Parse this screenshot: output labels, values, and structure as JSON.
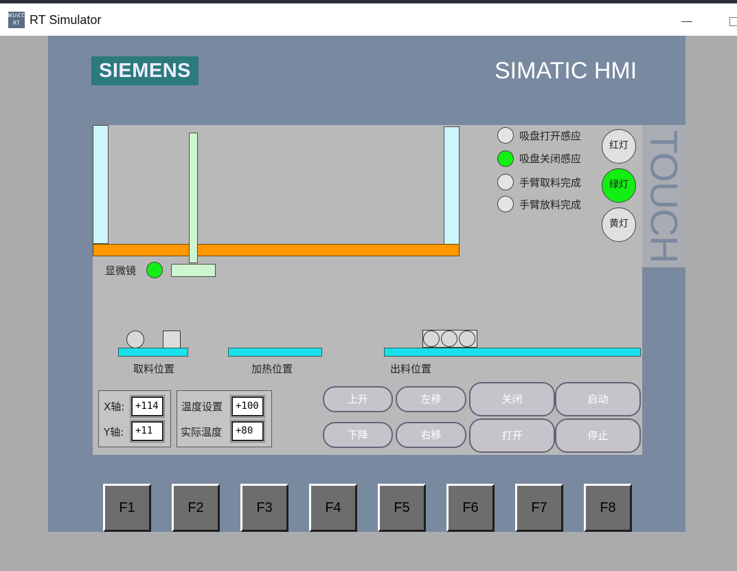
{
  "window": {
    "app_icon_text": [
      "WinCC",
      "RT"
    ],
    "title": "RT Simulator"
  },
  "panel": {
    "brand": "SIEMENS",
    "product": "SIMATIC HMI",
    "touch_label": "TOUCH"
  },
  "process": {
    "microscope_label": "显微镜",
    "positions": {
      "pick": "取料位置",
      "heat": "加热位置",
      "output": "出料位置"
    }
  },
  "sensors": [
    {
      "label": "吸盘打开感应",
      "active": false
    },
    {
      "label": "吸盘关闭感应",
      "active": true
    },
    {
      "label": "手臂取料完成",
      "active": false
    },
    {
      "label": "手臂放料完成",
      "active": false
    }
  ],
  "lamps": [
    {
      "label": "红灯",
      "active": false
    },
    {
      "label": "绿灯",
      "active": true
    },
    {
      "label": "黄灯",
      "active": false
    }
  ],
  "axes": {
    "x_label": "X轴:",
    "x_value": "+114",
    "y_label": "Y轴:",
    "y_value": "+11"
  },
  "temperature": {
    "set_label": "温度设置",
    "set_value": "+100",
    "actual_label": "实际温度",
    "actual_value": "+80"
  },
  "buttons": {
    "up": "上升",
    "down": "下降",
    "left": "左移",
    "right": "右移",
    "close": "关闭",
    "open": "打开",
    "start": "启动",
    "stop": "停止"
  },
  "function_keys": [
    "F1",
    "F2",
    "F3",
    "F4",
    "F5",
    "F6",
    "F7",
    "F8"
  ],
  "colors": {
    "indicator_on": "#13ee13",
    "conveyor": "#19e0ea",
    "rail": "#ff9700",
    "panel": "#7989a0",
    "brand": "#2c7a7b"
  }
}
